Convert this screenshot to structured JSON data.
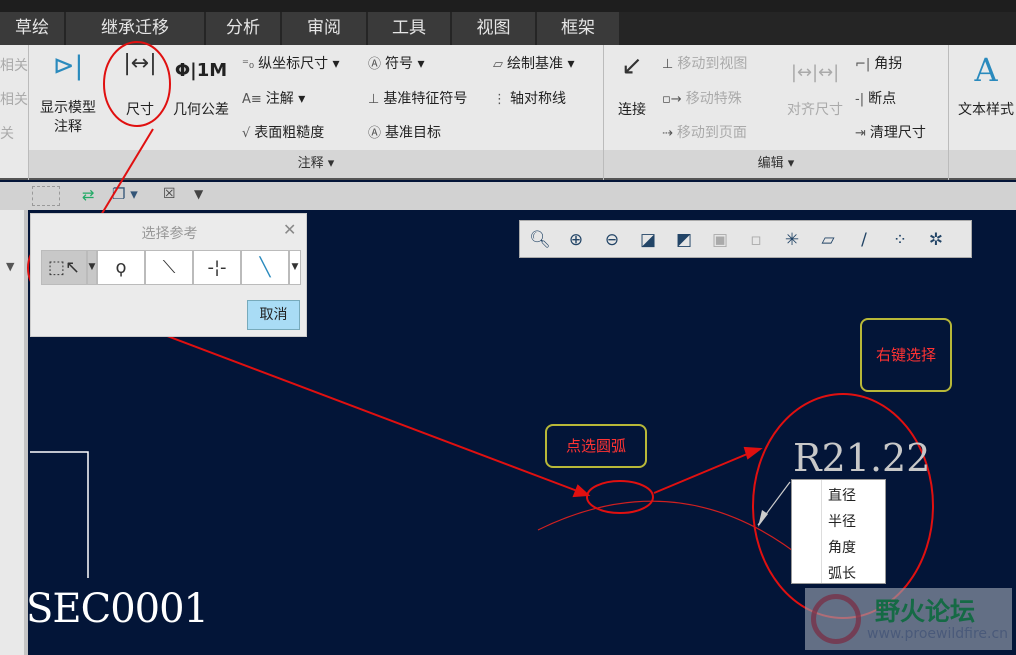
{
  "tabs": [
    "草绘",
    "继承迁移",
    "分析",
    "审阅",
    "工具",
    "视图",
    "框架"
  ],
  "ribbon": {
    "left_cut": [
      "相关",
      "相关",
      "关"
    ],
    "show_model_annotation": "显示模型\n注释",
    "dimension": "尺寸",
    "geometric_tolerance": "几何公差",
    "ordinate_dimension": "纵坐标尺寸",
    "note": "注解",
    "surface_finish": "表面粗糙度",
    "symbol": "符号",
    "datum_feature_symbol": "基准特征符号",
    "datum_target": "基准目标",
    "draw_datum": "绘制基准",
    "axis_symmetry_line": "轴对称线",
    "annotation_group": "注释",
    "connect": "连接",
    "move_to_view": "移动到视图",
    "move_special": "移动特殊",
    "move_to_page": "移动到页面",
    "align_dimension": "对齐尺寸",
    "jog": "角拐",
    "breakpoint": "断点",
    "cleanup_dimension": "清理尺寸",
    "edit_group": "编辑",
    "text_style": "文本样式"
  },
  "dialog": {
    "title": "选择参考",
    "cancel": "取消"
  },
  "canvas": {
    "section_label": "SEC0001",
    "dimension_text": "R21.22"
  },
  "callouts": {
    "right_click": "右键选择",
    "pick_arc": "点选圆弧"
  },
  "context_menu": [
    "直径",
    "半径",
    "角度",
    "弧长"
  ],
  "watermark": {
    "name": "野火论坛",
    "url": "www.proewildfire.cn"
  },
  "colors": {
    "canvas": "#031538",
    "annotation_red": "#e01010",
    "callout_border": "#b8b838"
  }
}
